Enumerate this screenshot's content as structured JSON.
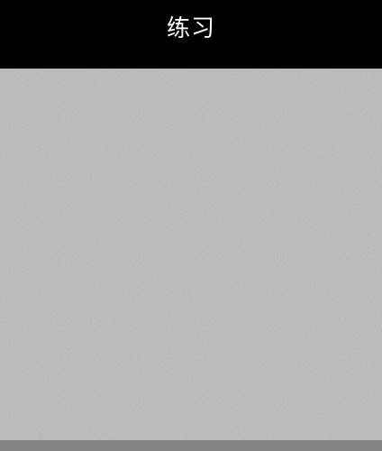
{
  "header": {
    "title": "练习"
  },
  "colors": {
    "header_background": "#000000",
    "title_text": "#ffffff",
    "noise_base": "#808080",
    "bottom_strip": "#848484"
  }
}
